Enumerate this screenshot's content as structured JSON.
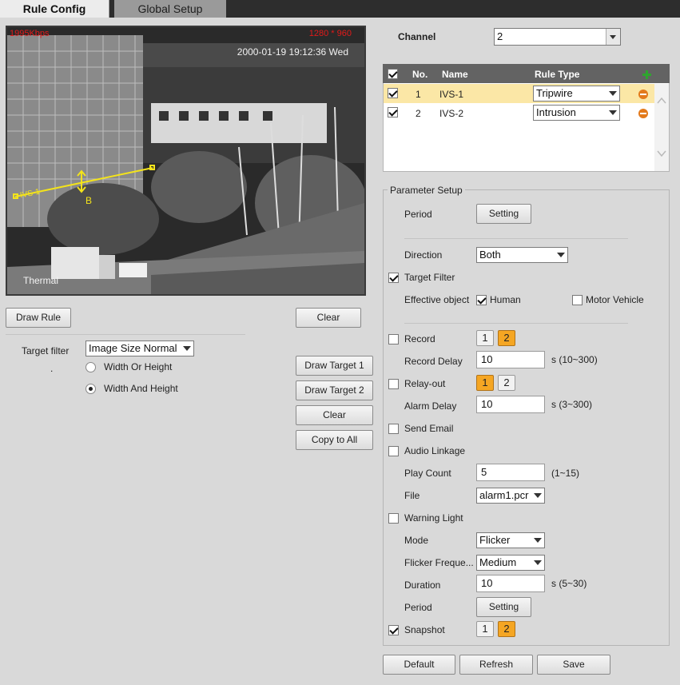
{
  "tabs": {
    "rule_config": "Rule Config",
    "global_setup": "Global Setup"
  },
  "video": {
    "bitrate": "1995Kbps",
    "resolution": "1280 * 960",
    "timestamp": "2000-01-19 19:12:36 Wed",
    "channel_label": "Thermal",
    "rule_line_label": "IVS-1",
    "direction_label": "B"
  },
  "left": {
    "draw_rule": "Draw Rule",
    "clear": "Clear",
    "target_filter_label": "Target filter",
    "target_filter_value": "Image Size Normal",
    "dot": ".",
    "width_or_height": "Width Or Height",
    "width_and_height": "Width And Height",
    "draw_target_1": "Draw Target 1",
    "draw_target_2": "Draw Target 2",
    "clear2": "Clear",
    "copy_to_all": "Copy to All"
  },
  "channel": {
    "label": "Channel",
    "value": "2"
  },
  "rules_table": {
    "headers": {
      "no": "No.",
      "name": "Name",
      "rule_type": "Rule Type"
    },
    "rows": [
      {
        "no": "1",
        "name": "IVS-1",
        "rule_type": "Tripwire"
      },
      {
        "no": "2",
        "name": "IVS-2",
        "rule_type": "Intrusion"
      }
    ]
  },
  "params": {
    "legend": "Parameter Setup",
    "period_label": "Period",
    "setting": "Setting",
    "direction_label": "Direction",
    "direction_value": "Both",
    "target_filter": "Target Filter",
    "effective_object": "Effective object",
    "human": "Human",
    "motor_vehicle": "Motor Vehicle",
    "record": "Record",
    "record_delay": "Record Delay",
    "record_delay_value": "10",
    "record_delay_range": "s (10~300)",
    "relay_out": "Relay-out",
    "alarm_delay": "Alarm Delay",
    "alarm_delay_value": "10",
    "alarm_delay_range": "s (3~300)",
    "send_email": "Send Email",
    "audio_linkage": "Audio Linkage",
    "play_count": "Play Count",
    "play_count_value": "5",
    "play_count_range": "(1~15)",
    "file": "File",
    "file_value": "alarm1.pcr",
    "warning_light": "Warning Light",
    "mode": "Mode",
    "mode_value": "Flicker",
    "flicker_freq": "Flicker Freque...",
    "flicker_freq_value": "Medium",
    "duration": "Duration",
    "duration_value": "10",
    "duration_range": "s (5~30)",
    "period2_label": "Period",
    "setting2": "Setting",
    "snapshot": "Snapshot",
    "n1": "1",
    "n2": "2"
  },
  "footer": {
    "default": "Default",
    "refresh": "Refresh",
    "save": "Save"
  },
  "colors": {
    "accent": "#f5a623",
    "row_highlight": "#fbe7a6",
    "add_icon": "#2fa52f",
    "remove_icon": "#e37a1b"
  }
}
